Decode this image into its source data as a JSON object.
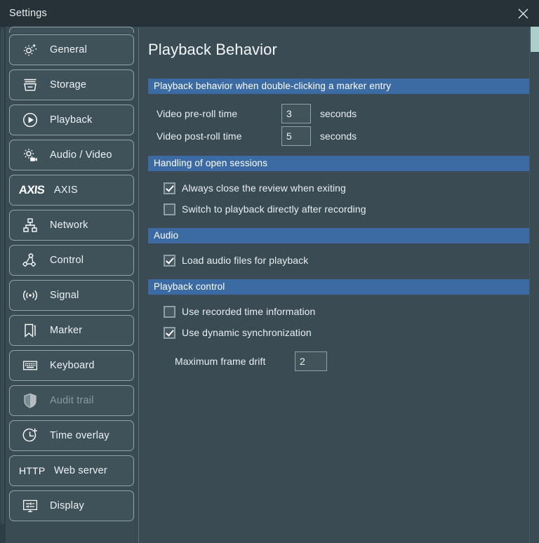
{
  "window": {
    "title": "Settings",
    "close_icon": "close-icon"
  },
  "sidebar": {
    "items": [
      {
        "label": "General",
        "icon": "sparkle-gear-icon",
        "disabled": false
      },
      {
        "label": "Storage",
        "icon": "storage-bin-icon",
        "disabled": false
      },
      {
        "label": "Playback",
        "icon": "play-circle-icon",
        "disabled": false
      },
      {
        "label": "Audio / Video",
        "icon": "gear-camera-icon",
        "disabled": false
      },
      {
        "label": "AXIS",
        "icon": "axis-logo-icon",
        "disabled": false,
        "logo_text": "AXIS"
      },
      {
        "label": "Network",
        "icon": "network-tree-icon",
        "disabled": false
      },
      {
        "label": "Control",
        "icon": "control-gears-icon",
        "disabled": false
      },
      {
        "label": "Signal",
        "icon": "signal-waves-icon",
        "disabled": false
      },
      {
        "label": "Marker",
        "icon": "bookmark-icon",
        "disabled": false
      },
      {
        "label": "Keyboard",
        "icon": "keyboard-icon",
        "disabled": false
      },
      {
        "label": "Audit trail",
        "icon": "shield-icon",
        "disabled": true
      },
      {
        "label": "Time overlay",
        "icon": "clock-plus-icon",
        "disabled": false
      },
      {
        "label": "Web server",
        "icon": "http-text-icon",
        "disabled": false,
        "logo_text": "HTTP"
      },
      {
        "label": "Display",
        "icon": "monitor-sliders-icon",
        "disabled": false
      }
    ]
  },
  "main": {
    "page_title": "Playback Behavior",
    "sections": {
      "marker": {
        "header": "Playback behavior when double-clicking a marker entry",
        "pre_roll": {
          "label": "Video pre-roll time",
          "value": "3",
          "unit": "seconds"
        },
        "post_roll": {
          "label": "Video post-roll time",
          "value": "5",
          "unit": "seconds"
        }
      },
      "sessions": {
        "header": "Handling of open sessions",
        "checks": [
          {
            "label": "Always close the review when exiting",
            "checked": true
          },
          {
            "label": "Switch to playback directly after recording",
            "checked": false
          }
        ]
      },
      "audio": {
        "header": "Audio",
        "checks": [
          {
            "label": "Load audio files for playback",
            "checked": true
          }
        ]
      },
      "control": {
        "header": "Playback control",
        "checks": [
          {
            "label": "Use recorded time information",
            "checked": false
          },
          {
            "label": "Use dynamic synchronization",
            "checked": true
          }
        ],
        "frame_drift": {
          "label": "Maximum frame drift",
          "value": "2"
        }
      }
    }
  },
  "colors": {
    "window_bg": "#3b4b53",
    "titlebar_bg": "#263238",
    "section_header": "#3c6ba4",
    "border": "#8fa3ab",
    "text": "#eaeff1",
    "disabled_text": "#8b9aa1",
    "scroll_accent": "#a9cfc8"
  }
}
